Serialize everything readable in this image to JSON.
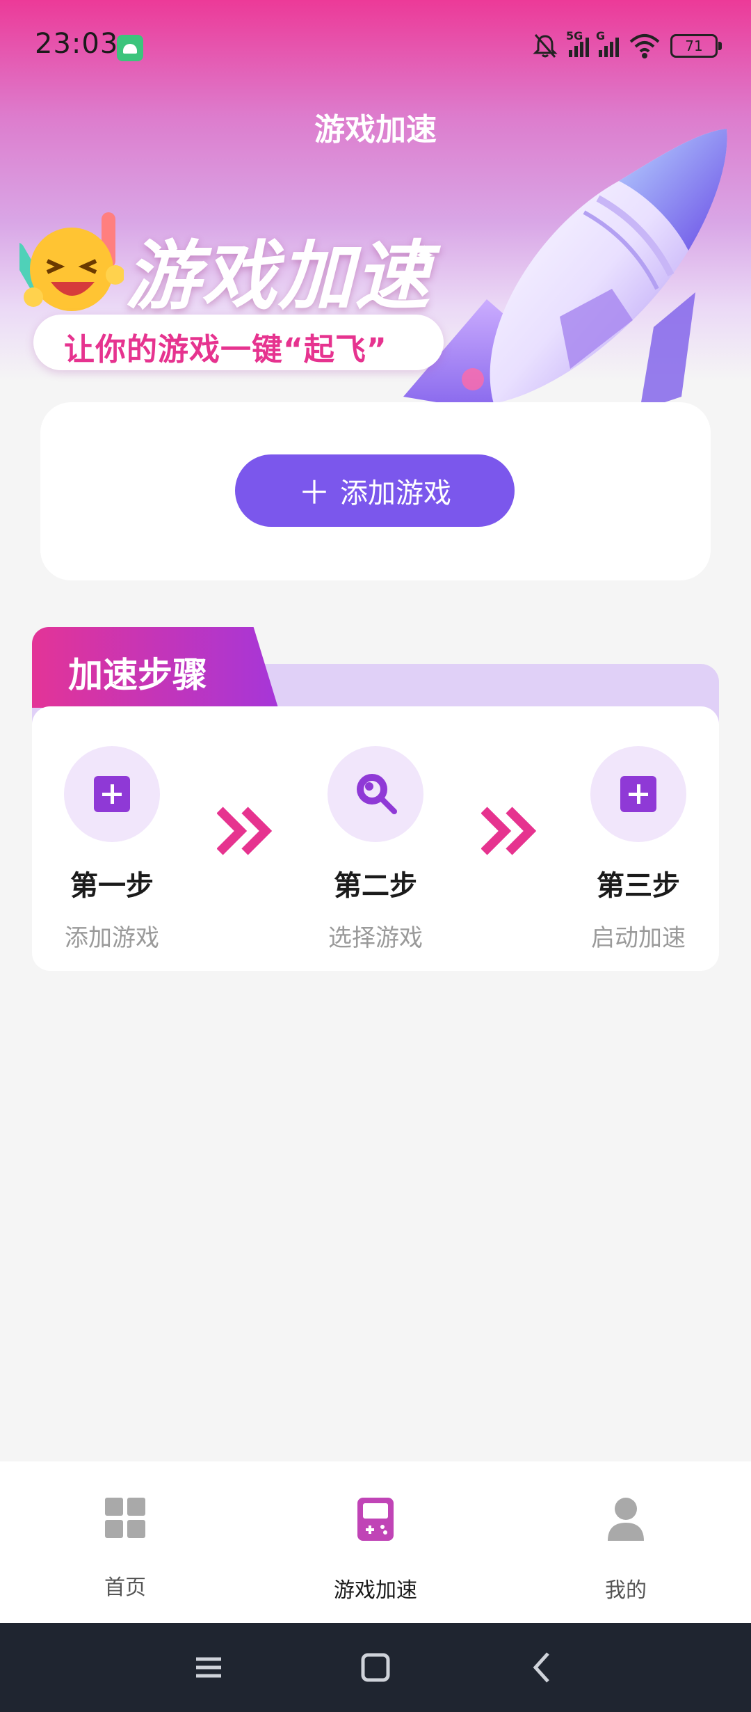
{
  "status_bar": {
    "time": "23:03",
    "network": "5G",
    "network2": "G",
    "battery": "71"
  },
  "header": {
    "title": "游戏加速"
  },
  "banner": {
    "title": "游戏加速",
    "subtitle": "让你的游戏一键“起飞”"
  },
  "add_card": {
    "button_label": "添加游戏",
    "button_icon": "plus-icon"
  },
  "steps": {
    "heading": "加速步骤",
    "items": [
      {
        "title": "第一步",
        "subtitle": "添加游戏",
        "icon": "add-square-icon"
      },
      {
        "title": "第二步",
        "subtitle": "选择游戏",
        "icon": "search-icon"
      },
      {
        "title": "第三步",
        "subtitle": "启动加速",
        "icon": "add-square-icon"
      }
    ]
  },
  "tabbar": {
    "items": [
      {
        "label": "首页",
        "icon": "grid-icon",
        "active": false
      },
      {
        "label": "游戏加速",
        "icon": "gamepad-icon",
        "active": true
      },
      {
        "label": "我的",
        "icon": "person-icon",
        "active": false
      }
    ]
  },
  "colors": {
    "accent": "#7b57ec",
    "pink": "#e6338f",
    "tab_active": "#c044b6",
    "tab_inactive": "#a9a9a9"
  }
}
